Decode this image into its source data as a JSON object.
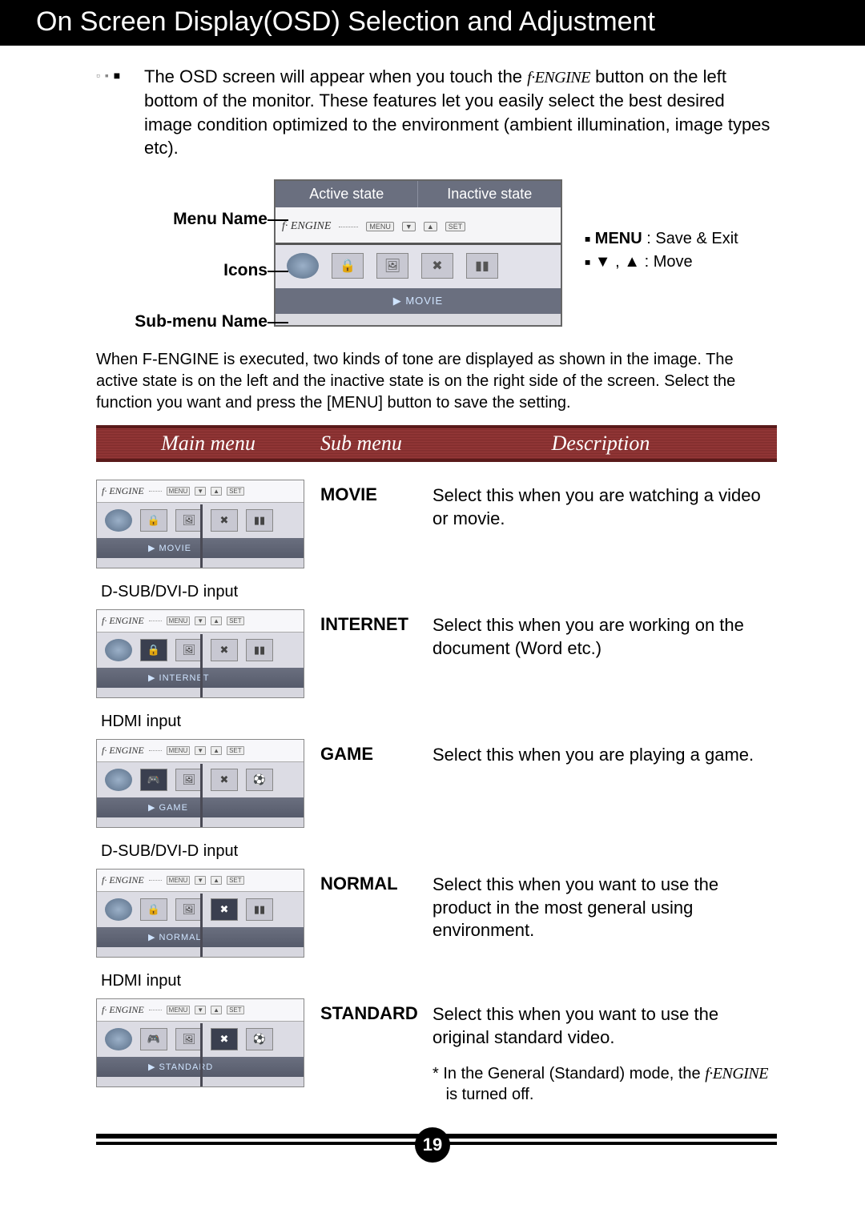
{
  "title": "On Screen Display(OSD) Selection and Adjustment",
  "intro_line": "The OSD screen will appear when you touch the ",
  "intro_btn": "f·ENGINE",
  "intro_rest": " button on the left bottom of the monitor. These features let you easily select the best desired image condition optimized to the environment (ambient illumination, image types etc).",
  "diagram": {
    "labels": {
      "menu": "Menu Name",
      "icons": "Icons",
      "submenu": "Sub-menu Name"
    },
    "state_active": "Active state",
    "state_inactive": "Inactive state",
    "engine": "f· ENGINE",
    "mini_btns": [
      "MENU",
      "▼",
      "▲",
      "SET"
    ],
    "submenu_text": "▶ MOVIE",
    "legend_menu": "MENU",
    "legend_menu_desc": " : Save & Exit",
    "legend_move": " : Move"
  },
  "mid_paragraph": "When F-ENGINE is executed, two kinds of tone are displayed as shown in the image. The active state is on the left and the inactive state is on the right side of the screen. Select the function you want and press the [MENU] button to save the setting.",
  "columns": {
    "main": "Main menu",
    "sub": "Sub menu",
    "desc": "Description"
  },
  "rows": [
    {
      "input_label": "",
      "engine": "f· ENGINE",
      "mini_btns": [
        "MENU",
        "▼",
        "▲",
        "SET"
      ],
      "submenu": "▶ MOVIE",
      "icons": [
        "globe",
        "lock",
        "photo",
        "x",
        "bars"
      ],
      "sub": "MOVIE",
      "desc": "Select this when you are watching a video or movie."
    },
    {
      "input_label": "D-SUB/DVI-D input",
      "engine": "f· ENGINE",
      "mini_btns": [
        "MENU",
        "▼",
        "▲",
        "SET"
      ],
      "submenu": "▶ INTERNET",
      "icons": [
        "globe",
        "lock",
        "photo",
        "x",
        "bars"
      ],
      "sub": "INTERNET",
      "desc": "Select this when you are working on the document (Word etc.)"
    },
    {
      "input_label": "HDMI input",
      "engine": "f· ENGINE",
      "mini_btns": [
        "MENU",
        "▼",
        "▲",
        "SET"
      ],
      "submenu": "▶ GAME",
      "icons": [
        "globe",
        "game",
        "photo",
        "x",
        "sport"
      ],
      "sub": "GAME",
      "desc": "Select this when you are playing a game."
    },
    {
      "input_label": "D-SUB/DVI-D input",
      "engine": "f· ENGINE",
      "mini_btns": [
        "MENU",
        "▼",
        "▲",
        "SET"
      ],
      "submenu": "▶ NORMAL",
      "icons": [
        "globe",
        "lock",
        "photo",
        "x",
        "bars"
      ],
      "sub": "NORMAL",
      "desc": "Select this when you want to use the product in the most general using environment."
    },
    {
      "input_label": "HDMI input",
      "engine": "f· ENGINE",
      "mini_btns": [
        "MENU",
        "▼",
        "▲",
        "SET"
      ],
      "submenu": "▶ STANDARD",
      "icons": [
        "globe",
        "game",
        "photo",
        "x",
        "sport"
      ],
      "sub": "STANDARD",
      "desc": "Select this when you want to use the original standard video."
    }
  ],
  "footnote_pre": "* In the General (Standard) mode, the ",
  "footnote_eng": "f·ENGINE",
  "footnote_post": " is turned off.",
  "page": "19"
}
